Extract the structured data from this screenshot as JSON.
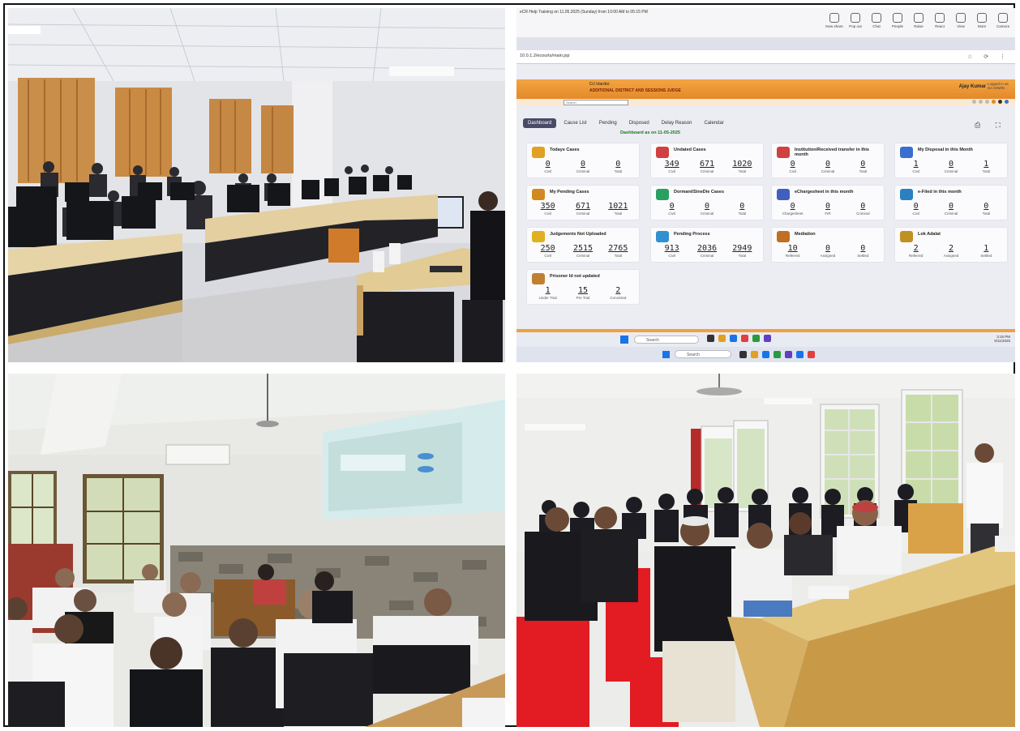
{
  "meeting": {
    "title": "eCR Help Training on 11.05.2025 (Sunday) from 10:00 AM to 05:15 PM",
    "tools": [
      "New share",
      "Pop out",
      "Chat",
      "People",
      "Raise",
      "React",
      "View",
      "More",
      "Camera"
    ]
  },
  "browser": {
    "url": "10.0.1.2/ecourts/main.jsp",
    "icons": "☆ ⟳ ⋮"
  },
  "app": {
    "header_user": "DJ Hardoi",
    "header_court": "ADDITIONAL DISTRICT AND SESSIONS JUDGE",
    "header_name": "Ajay Kumar",
    "header_role": "Logged in as DJ ADMIN",
    "search_placeholder": "Search",
    "tabs": [
      "Dashboard",
      "Cause List",
      "Pending",
      "Disposed",
      "Delay Reason",
      "Calendar"
    ],
    "dashboard_date": "Dashboard as on 11-05-2025",
    "nav_right_icons": "⎙ ⛶",
    "cards": [
      {
        "title": "Todays Cases",
        "color": "#e0a020",
        "vals": [
          {
            "n": "0",
            "l": "Civil"
          },
          {
            "n": "0",
            "l": "Criminal"
          },
          {
            "n": "0",
            "l": "Total"
          }
        ]
      },
      {
        "title": "Undated Cases",
        "color": "#d04040",
        "vals": [
          {
            "n": "349",
            "l": "Civil"
          },
          {
            "n": "671",
            "l": "Criminal"
          },
          {
            "n": "1020",
            "l": "Total"
          }
        ]
      },
      {
        "title": "Institution/Received transfer in this month",
        "color": "#d04040",
        "vals": [
          {
            "n": "0",
            "l": "Civil"
          },
          {
            "n": "0",
            "l": "Criminal"
          },
          {
            "n": "0",
            "l": "Total"
          }
        ]
      },
      {
        "title": "My Disposal in this Month",
        "color": "#3a6fd0",
        "vals": [
          {
            "n": "1",
            "l": "Civil"
          },
          {
            "n": "0",
            "l": "Criminal"
          },
          {
            "n": "1",
            "l": "Total"
          }
        ]
      },
      {
        "title": "My Pending Cases",
        "color": "#d08a20",
        "vals": [
          {
            "n": "350",
            "l": "Civil"
          },
          {
            "n": "671",
            "l": "Criminal"
          },
          {
            "n": "1021",
            "l": "Total"
          }
        ]
      },
      {
        "title": "Dormant/SineDie Cases",
        "color": "#2aa060",
        "vals": [
          {
            "n": "0",
            "l": "Civil"
          },
          {
            "n": "0",
            "l": "Criminal"
          },
          {
            "n": "0",
            "l": "Total"
          }
        ]
      },
      {
        "title": "eChargesheet in this month",
        "color": "#4060c0",
        "vals": [
          {
            "n": "0",
            "l": "Chargesheet"
          },
          {
            "n": "0",
            "l": "FIR"
          },
          {
            "n": "0",
            "l": "Criminal"
          }
        ]
      },
      {
        "title": "e-Filed in this month",
        "color": "#2a80c0",
        "vals": [
          {
            "n": "0",
            "l": "Civil"
          },
          {
            "n": "0",
            "l": "Criminal"
          },
          {
            "n": "0",
            "l": "Total"
          }
        ]
      },
      {
        "title": "Judgements Not Uploaded",
        "color": "#e0b020",
        "vals": [
          {
            "n": "250",
            "l": "Civil"
          },
          {
            "n": "2515",
            "l": "Criminal"
          },
          {
            "n": "2765",
            "l": "Total"
          }
        ]
      },
      {
        "title": "Pending Process",
        "color": "#3090d0",
        "vals": [
          {
            "n": "913",
            "l": "Civil"
          },
          {
            "n": "2036",
            "l": "Criminal"
          },
          {
            "n": "2949",
            "l": "Total"
          }
        ]
      },
      {
        "title": "Mediation",
        "color": "#c07020",
        "vals": [
          {
            "n": "10",
            "l": "Referred"
          },
          {
            "n": "0",
            "l": "Assigned"
          },
          {
            "n": "0",
            "l": "Settled"
          }
        ]
      },
      {
        "title": "Lok Adalat",
        "color": "#c09020",
        "vals": [
          {
            "n": "2",
            "l": "Referred"
          },
          {
            "n": "2",
            "l": "Assigned"
          },
          {
            "n": "1",
            "l": "Settled"
          }
        ]
      },
      {
        "title": "Prisoner Id not updated",
        "color": "#c08030",
        "vals": [
          {
            "n": "1",
            "l": "Under Trial"
          },
          {
            "n": "15",
            "l": "Pre Trial"
          },
          {
            "n": "2",
            "l": "Convicted"
          }
        ]
      }
    ],
    "under_trial_label": "Under Trial"
  },
  "taskbar": {
    "search": "Search",
    "search2": "Search",
    "time": "3:15 PM",
    "date": "5/11/2025",
    "locale": "ENG IN"
  }
}
